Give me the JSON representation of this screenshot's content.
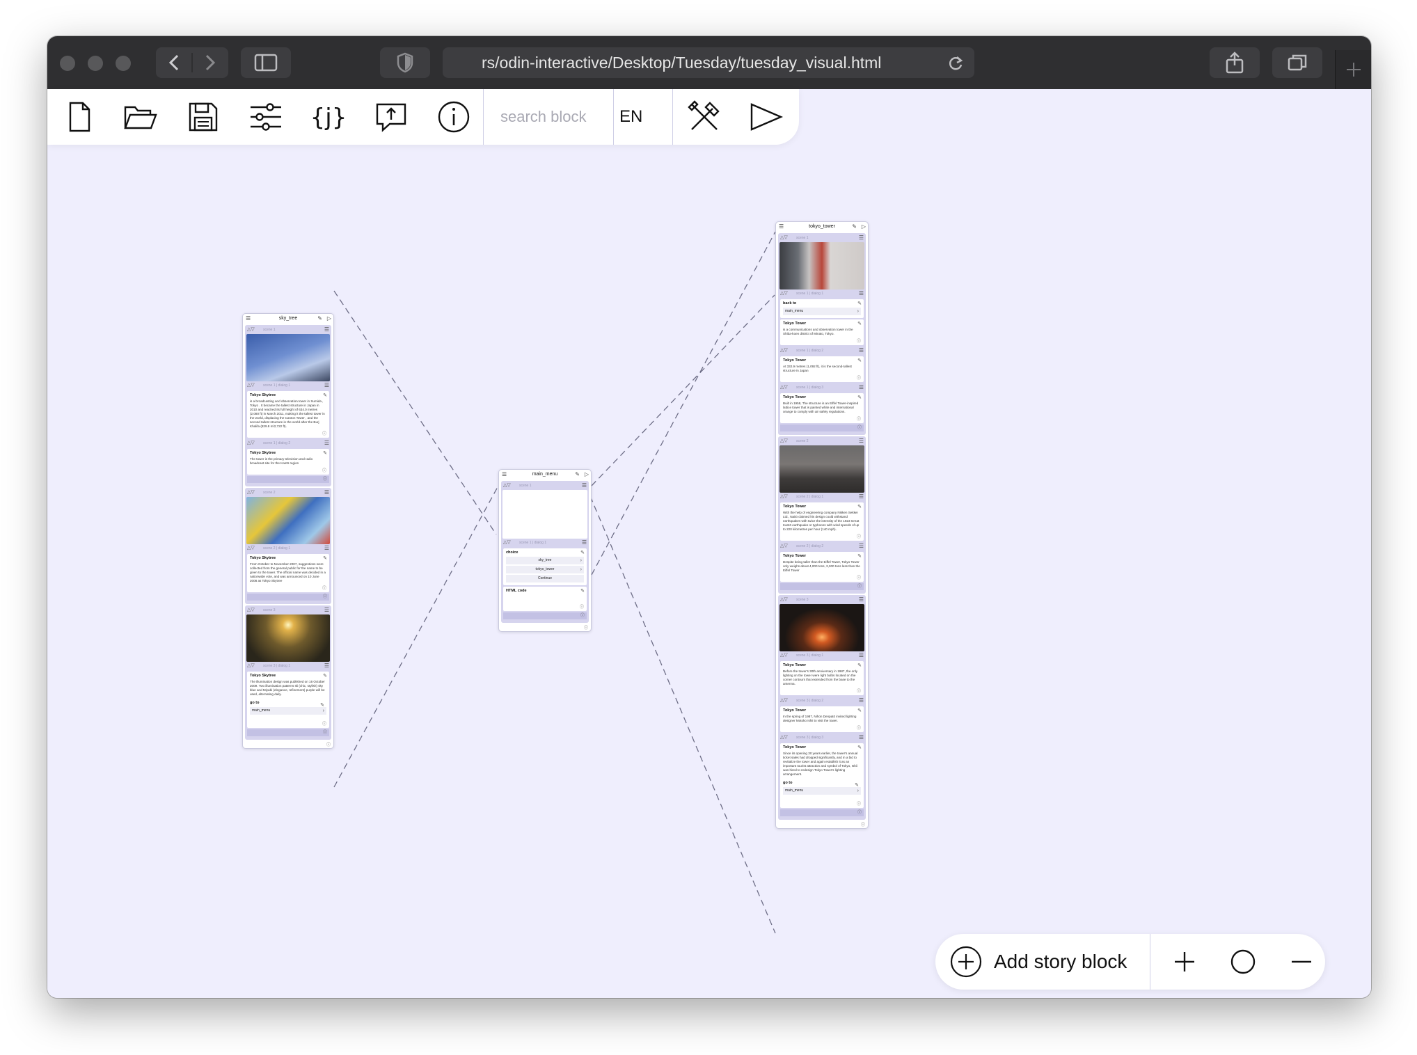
{
  "browser": {
    "url": "rs/odin-interactive/Desktop/Tuesday/tuesday_visual.html"
  },
  "toolbar": {
    "icons": [
      "new-file-icon",
      "open-folder-icon",
      "save-icon",
      "settings-sliders-icon",
      "json-icon",
      "export-icon",
      "info-icon",
      "tools-icon",
      "play-icon"
    ],
    "search_placeholder": "search block",
    "language": "EN"
  },
  "blocks": {
    "sky_tree": {
      "title": "sky_tree",
      "scenes": [
        {
          "label": "scene 1",
          "photo": "sky",
          "dialogs": [
            {
              "meta": "scene 1 | dialog 1",
              "title": "Tokyo Skytree",
              "text": "is a broadcasting and observation tower in Sumida , Tokyo . It became the tallest structure in Japan in 2010 and reached its full height of 634.0 metres (2,080 ft) in March 2011, making it the tallest tower in the world, displacing the Canton Tower , and the second tallest structure in the world after the Burj Khalifa (829.8 m/2,722 ft)."
            },
            {
              "meta": "scene 1 | dialog 2",
              "title": "Tokyo Skytree",
              "text": "The tower is the primary television and radio broadcast site for the Kantō region"
            }
          ]
        },
        {
          "label": "scene 2",
          "photo": "mascot",
          "dialogs": [
            {
              "meta": "scene 2 | dialog 1",
              "title": "Tokyo Skytree",
              "text": "From October to November 2007, suggestions were collected from the general public for the name to be given to the tower. The official name was decided in a nationwide vote, and was announced on 10 June 2008 as Tokyo Skytree"
            }
          ]
        },
        {
          "label": "scene 3",
          "photo": "sunset",
          "dialogs": [
            {
              "meta": "scene 3 | dialog 1",
              "title": "Tokyo Skytree",
              "text": "The illumination design was published on 16 October 2009. Two illumination patterns Iki (chic, stylish) sky blue and Miyabi (elegance, refinement) purple will be used, alternating daily."
            }
          ],
          "goto": {
            "title": "go to",
            "target": "main_menu"
          }
        }
      ]
    },
    "main_menu": {
      "title": "main_menu",
      "scene_label": "scene 1",
      "dialog_meta": "scene 1 | dialog 1",
      "choice_title": "choice",
      "options": [
        "sky_tree",
        "tokyo_tower",
        "Continue"
      ],
      "html_title": "HTML code"
    },
    "tokyo_tower": {
      "title": "tokyo_tower",
      "scenes": [
        {
          "label": "scene 1",
          "photo": "tower_day",
          "backto": {
            "meta": "scene 1 | dialog 1",
            "title": "back to",
            "target": "main_menu"
          },
          "dialogs": [
            {
              "meta": "",
              "title": "Tokyo Tower",
              "text": "is a communications and observation tower in the Shiba-koen district of Minato, Tokyo."
            },
            {
              "meta": "scene 1 | dialog 2",
              "title": "Tokyo Tower",
              "text": "At 332.9 metres (1,092 ft), it is the second-tallest structure in Japan"
            },
            {
              "meta": "scene 1 | dialog 3",
              "title": "Tokyo Tower",
              "text": "Built in 1958, The structure is an Eiffel Tower-inspired lattice tower that is painted white and international orange to comply with air safety regulations."
            }
          ]
        },
        {
          "label": "scene 2",
          "photo": "city",
          "dialogs": [
            {
              "meta": "scene 2 | dialog 1",
              "title": "Tokyo Tower",
              "text": "With the help of engineering company Nikken Sekkei Ltd., Naitō claimed his design could withstand earthquakes with twice the intensity of the 1923 Great Kantō earthquake or typhoons with wind speeds of up to 220 kilometres per hour (140 mph)."
            },
            {
              "meta": "scene 2 | dialog 2",
              "title": "Tokyo Tower",
              "text": "Despite being taller than the Eiffel Tower, Tokyo Tower only weighs about 4,000 tons, 3,300 tons less than the Eiffel Tower"
            }
          ]
        },
        {
          "label": "scene 3",
          "photo": "tower_night",
          "dialogs": [
            {
              "meta": "scene 3 | dialog 1",
              "title": "Tokyo Tower",
              "text": "Before the tower's 30th anniversary in 1987, the only lighting on the tower were light bulbs located on the corner contours that extended from the base to the antenna."
            },
            {
              "meta": "scene 3 | dialog 2",
              "title": "Tokyo Tower",
              "text": "In the spring of 1987, Nihon Denpatō invited lighting designer Motoko Ishii to visit the tower."
            },
            {
              "meta": "scene 3 | dialog 3",
              "title": "Tokyo Tower",
              "text": "Since its opening 30 years earlier, the tower's annual ticket sales had dropped significantly, and in a bid to revitalize the tower and again establish it as an important tourist attraction and symbol of Tokyo, Ishii was hired to redesign Tokyo Tower's lighting arrangement."
            }
          ],
          "goto": {
            "title": "go to",
            "target": "main_menu"
          }
        }
      ]
    }
  },
  "zoom": {
    "add_label": "Add story block",
    "icons": [
      "zoom-in-icon",
      "reset-zoom-icon",
      "zoom-out-icon"
    ]
  },
  "colors": {
    "canvas_bg": "#efeefd",
    "scene_bg": "#d6d4ee",
    "titlebar": "#2f2f31"
  }
}
